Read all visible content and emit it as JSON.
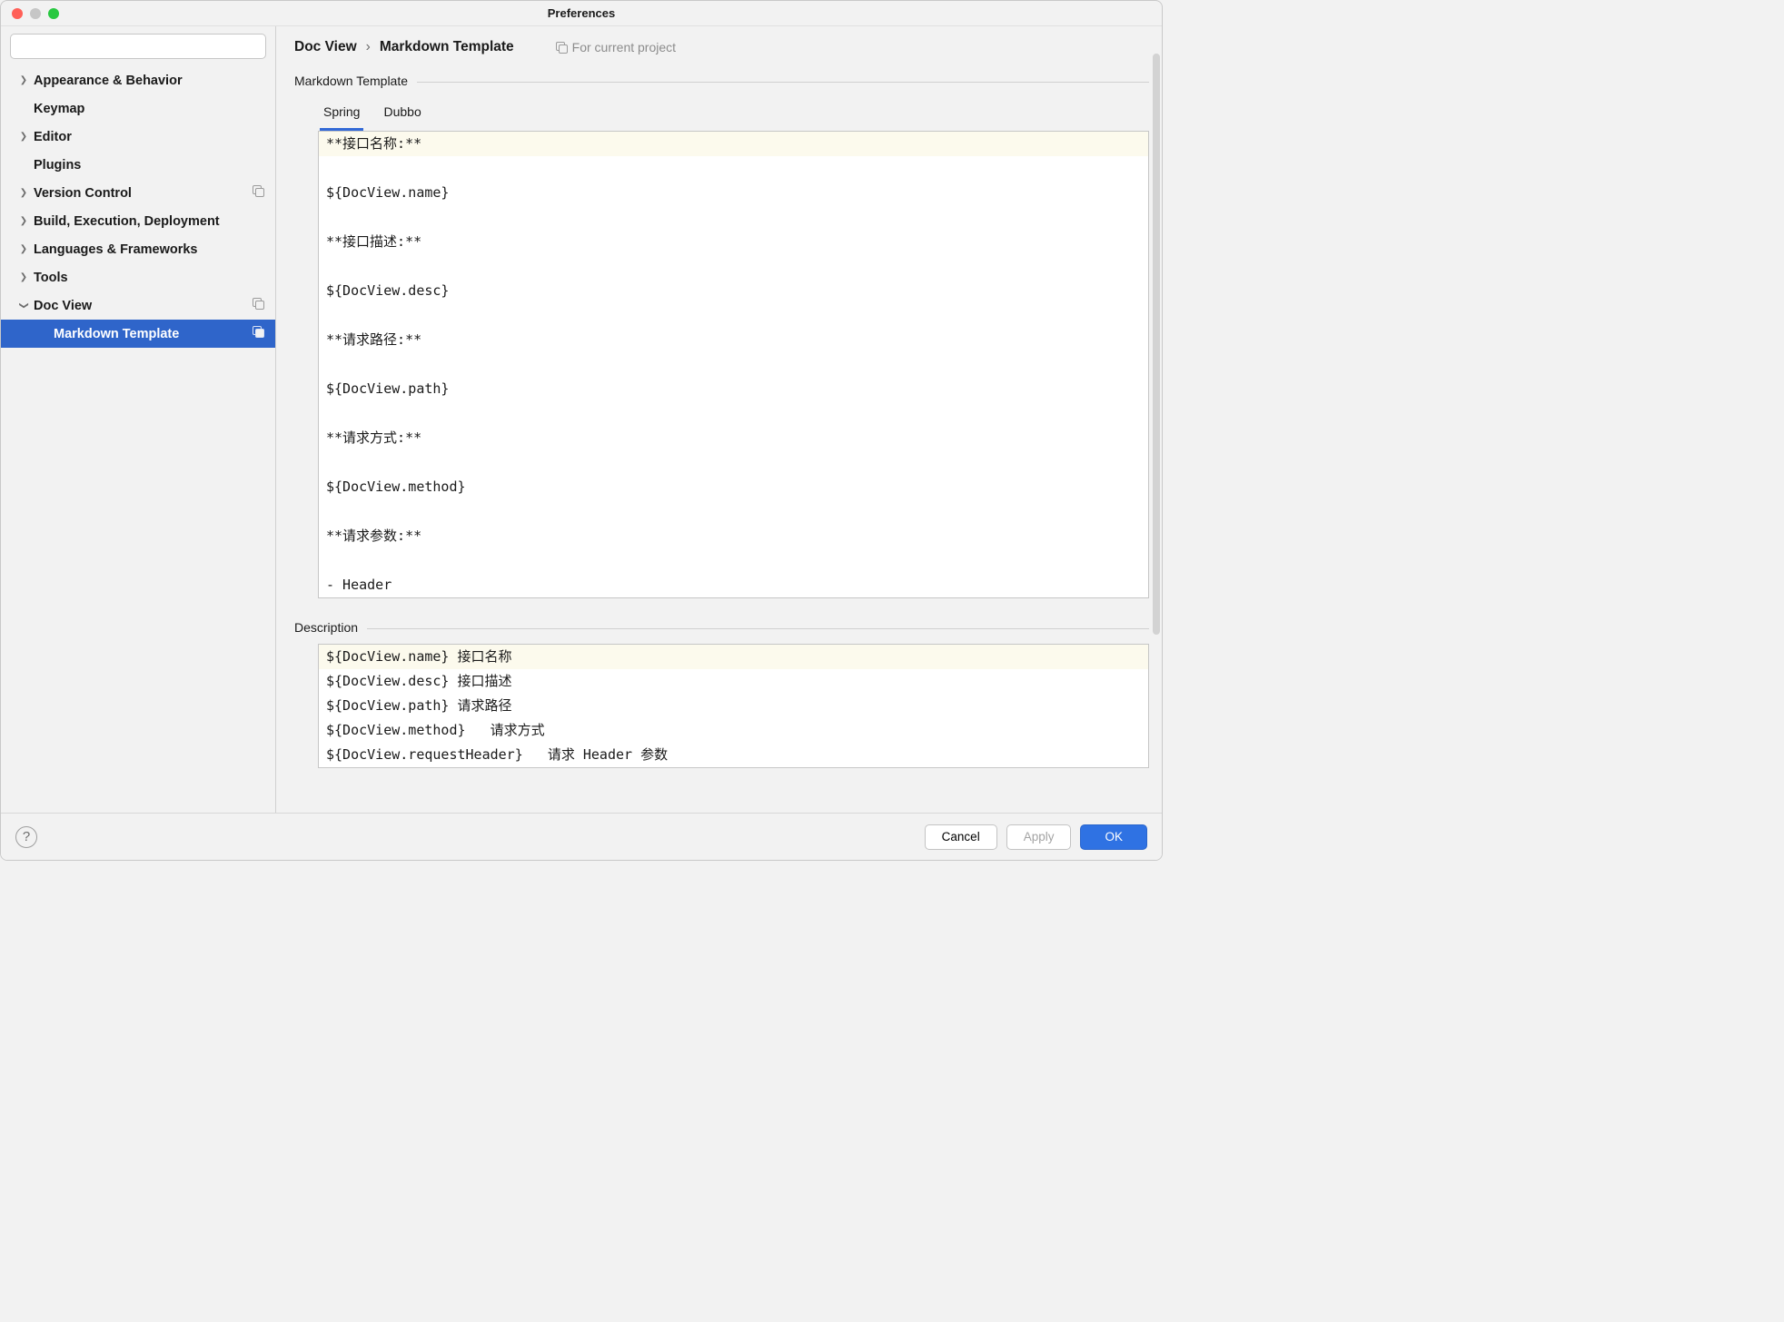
{
  "window": {
    "title": "Preferences"
  },
  "search": {
    "placeholder": ""
  },
  "sidebar": {
    "items": [
      {
        "label": "Appearance & Behavior",
        "expandable": true,
        "expanded": false,
        "badge": false
      },
      {
        "label": "Keymap",
        "expandable": false,
        "badge": false
      },
      {
        "label": "Editor",
        "expandable": true,
        "expanded": false,
        "badge": false
      },
      {
        "label": "Plugins",
        "expandable": false,
        "badge": false
      },
      {
        "label": "Version Control",
        "expandable": true,
        "expanded": false,
        "badge": true
      },
      {
        "label": "Build, Execution, Deployment",
        "expandable": true,
        "expanded": false,
        "badge": false
      },
      {
        "label": "Languages & Frameworks",
        "expandable": true,
        "expanded": false,
        "badge": false
      },
      {
        "label": "Tools",
        "expandable": true,
        "expanded": false,
        "badge": false
      },
      {
        "label": "Doc View",
        "expandable": true,
        "expanded": true,
        "badge": true
      }
    ],
    "doc_view_children": [
      {
        "label": "Markdown Template",
        "selected": true,
        "badge": true
      }
    ]
  },
  "breadcrumb": {
    "parent": "Doc View",
    "sep": "›",
    "current": "Markdown Template",
    "scope": "For current project"
  },
  "sections": {
    "template_label": "Markdown Template",
    "desc_label": "Description"
  },
  "tabs": [
    {
      "label": "Spring",
      "active": true
    },
    {
      "label": "Dubbo",
      "active": false
    }
  ],
  "editor_lines": [
    "**接口名称:**",
    "",
    "${DocView.name}",
    "",
    "**接口描述:**",
    "",
    "${DocView.desc}",
    "",
    "**请求路径:**",
    "",
    "${DocView.path}",
    "",
    "**请求方式:**",
    "",
    "${DocView.method}",
    "",
    "**请求参数:**",
    "",
    "- Header"
  ],
  "desc_lines": [
    "${DocView.name} 接口名称",
    "${DocView.desc} 接口描述",
    "${DocView.path} 请求路径",
    "${DocView.method}   请求方式",
    "${DocView.requestHeader}   请求 Header 参数"
  ],
  "footer": {
    "cancel": "Cancel",
    "apply": "Apply",
    "ok": "OK"
  }
}
